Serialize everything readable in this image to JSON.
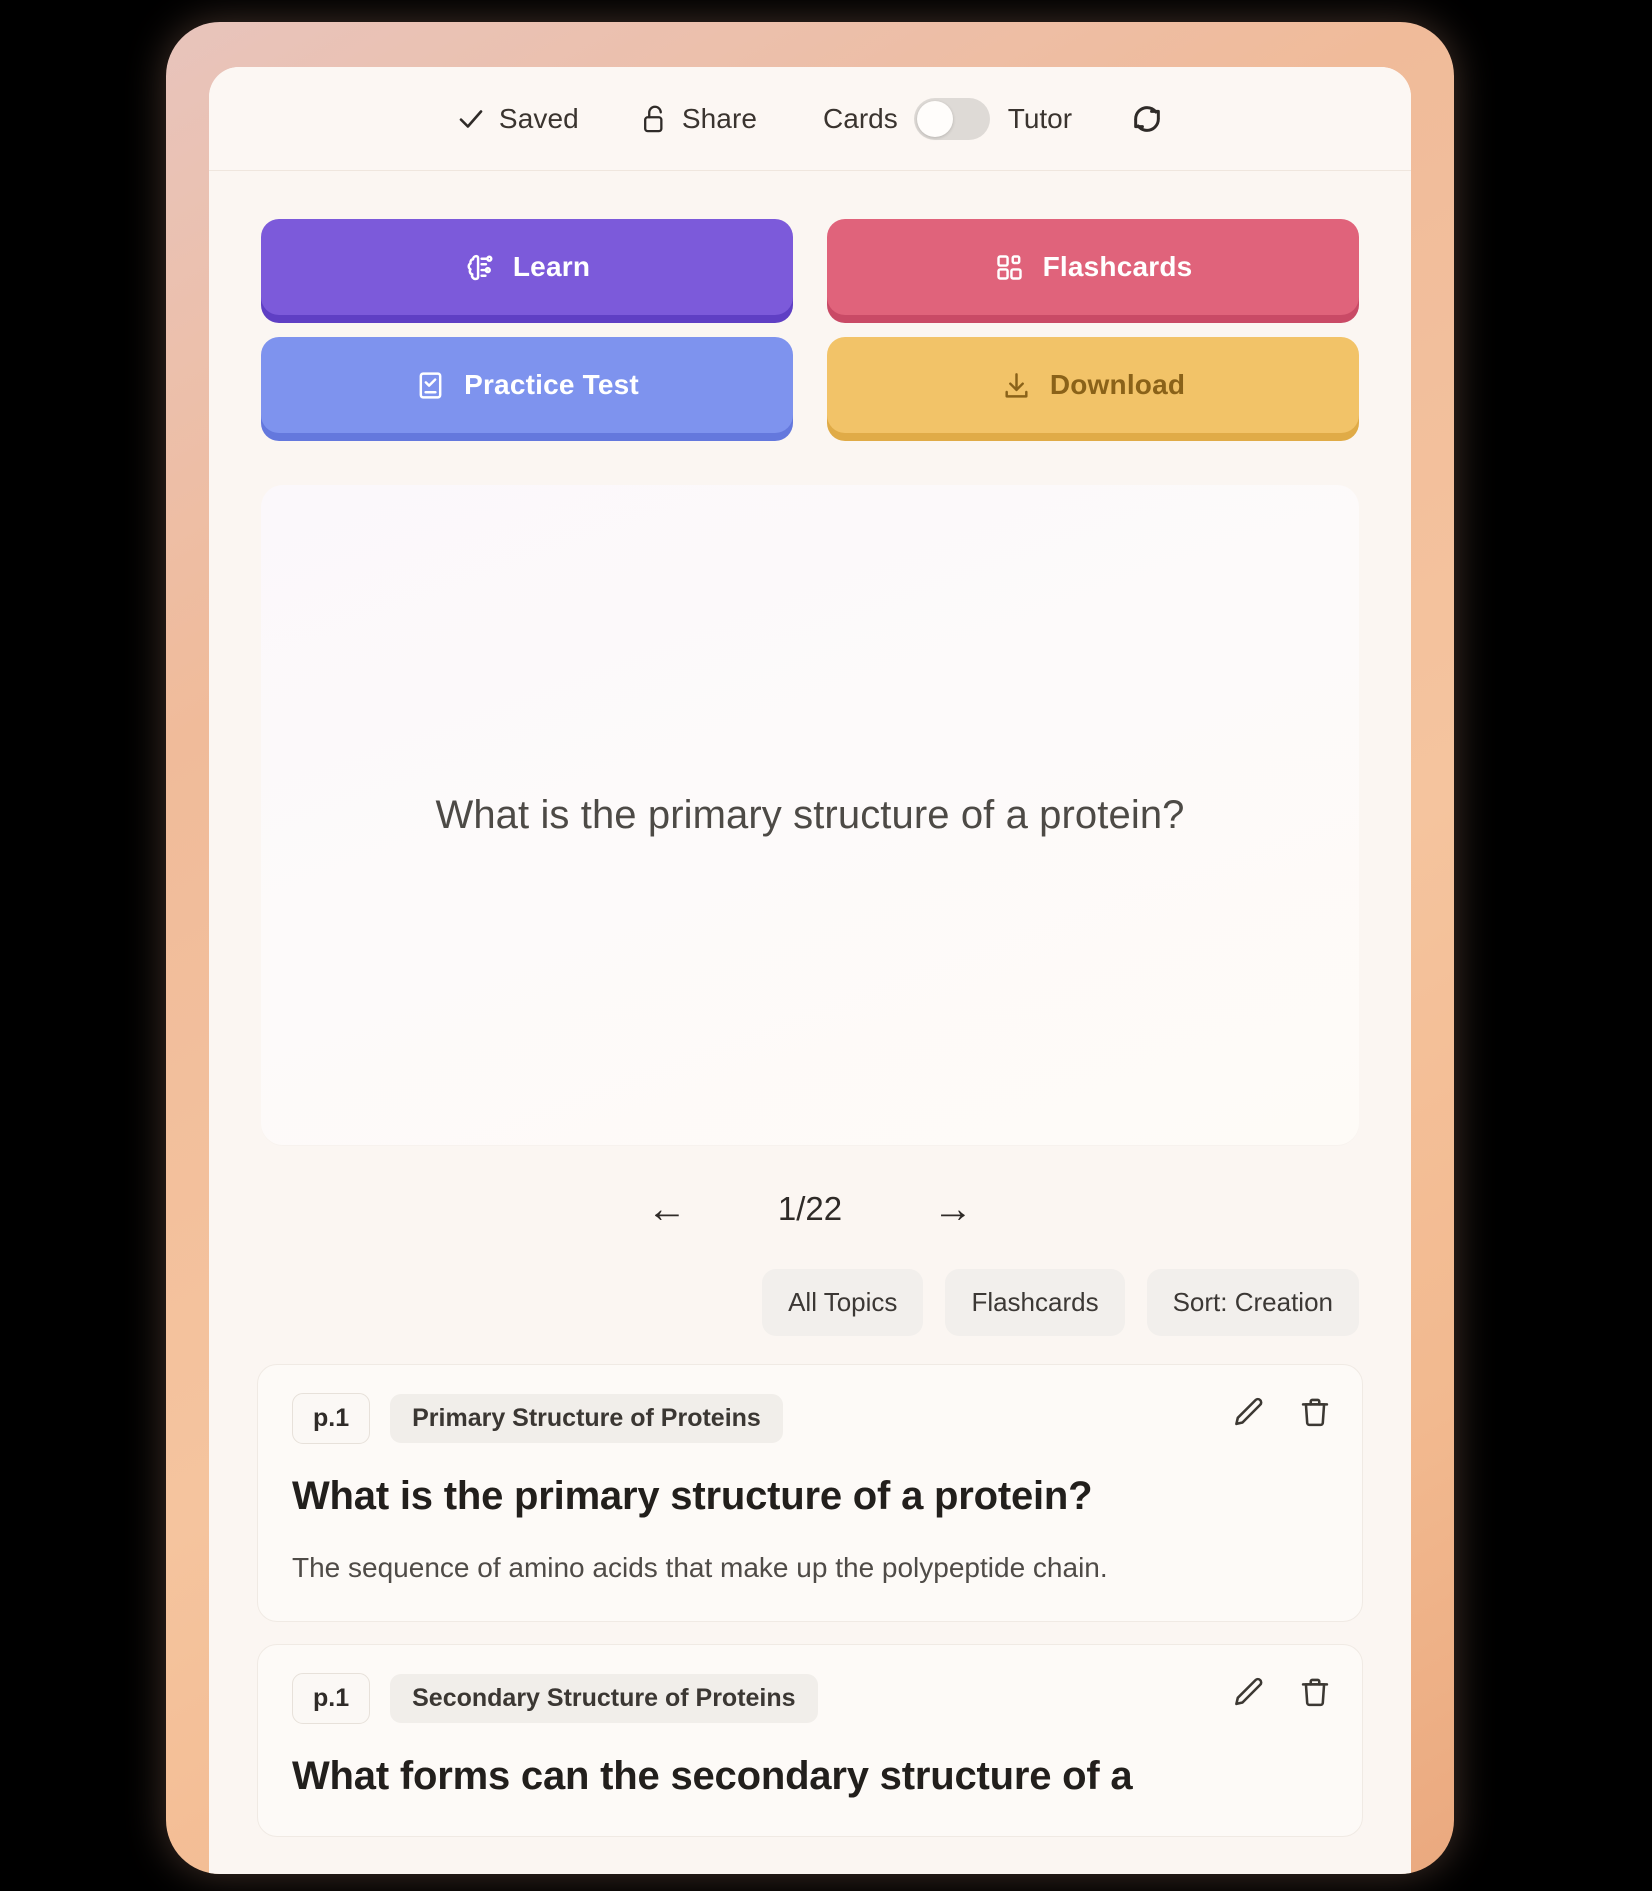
{
  "topbar": {
    "saved_label": "Saved",
    "saved_icon": "check-icon",
    "share_label": "Share",
    "share_icon": "unlock-icon",
    "cards_label": "Cards",
    "tutor_label": "Tutor",
    "toggle_state": "off",
    "refresh_icon": "refresh-icon"
  },
  "actions": [
    {
      "label": "Learn",
      "icon": "brain-icon",
      "color": "#7c5ada"
    },
    {
      "label": "Flashcards",
      "icon": "layout-grid-icon",
      "color": "#e0637b"
    },
    {
      "label": "Practice Test",
      "icon": "checked-page-icon",
      "color": "#7e93ee"
    },
    {
      "label": "Download",
      "icon": "download-arrow-icon",
      "color": "#f2c368"
    }
  ],
  "viewer": {
    "question": "What is the primary structure of a protein?",
    "pager": {
      "prev_icon": "arrow-left-icon",
      "next_icon": "arrow-right-icon",
      "count": "1/22"
    }
  },
  "filters": [
    {
      "label": "All Topics"
    },
    {
      "label": "Flashcards"
    },
    {
      "label": "Sort: Creation"
    }
  ],
  "cards": [
    {
      "page": "p.1",
      "topic": "Primary Structure of Proteins",
      "question": "What is the primary structure of a protein?",
      "answer": "The sequence of amino acids that make up the polypeptide chain.",
      "edit_icon": "pencil-icon",
      "delete_icon": "trash-icon"
    },
    {
      "page": "p.1",
      "topic": "Secondary Structure of Proteins",
      "question": "What forms can the secondary structure of a",
      "answer": "",
      "edit_icon": "pencil-icon",
      "delete_icon": "trash-icon"
    }
  ]
}
